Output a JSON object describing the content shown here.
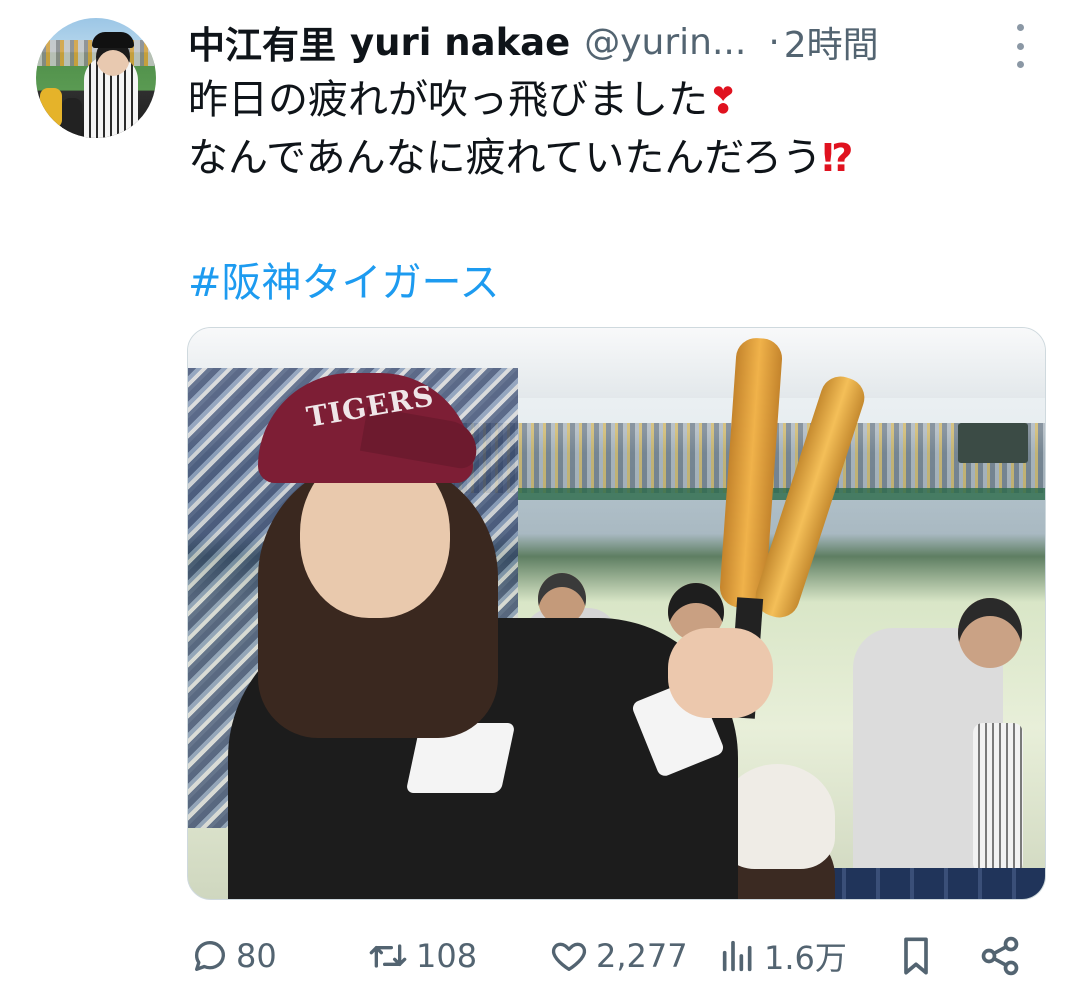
{
  "author": {
    "display_name": "中江有里",
    "username_display": "yuri nakae",
    "handle": "@yurin...",
    "timestamp": "2時間"
  },
  "tweet": {
    "line1": "昨日の疲れが吹っ飛びました",
    "line1_emoji": "❣",
    "line2": "なんであんなに疲れていたんだろう",
    "line2_emoji": "⁉",
    "hashtag": "#阪神タイガース"
  },
  "media": {
    "cap_text": "TIGERS"
  },
  "actions": {
    "replies": "80",
    "retweets": "108",
    "likes": "2,277",
    "views": "1.6万"
  },
  "colors": {
    "text": "#0f1419",
    "secondary": "#536471",
    "link": "#1d9bf0",
    "emoji_red": "#e0121f"
  },
  "icons": [
    "more-icon",
    "reply-icon",
    "retweet-icon",
    "like-icon",
    "views-icon",
    "bookmark-icon",
    "share-icon"
  ]
}
